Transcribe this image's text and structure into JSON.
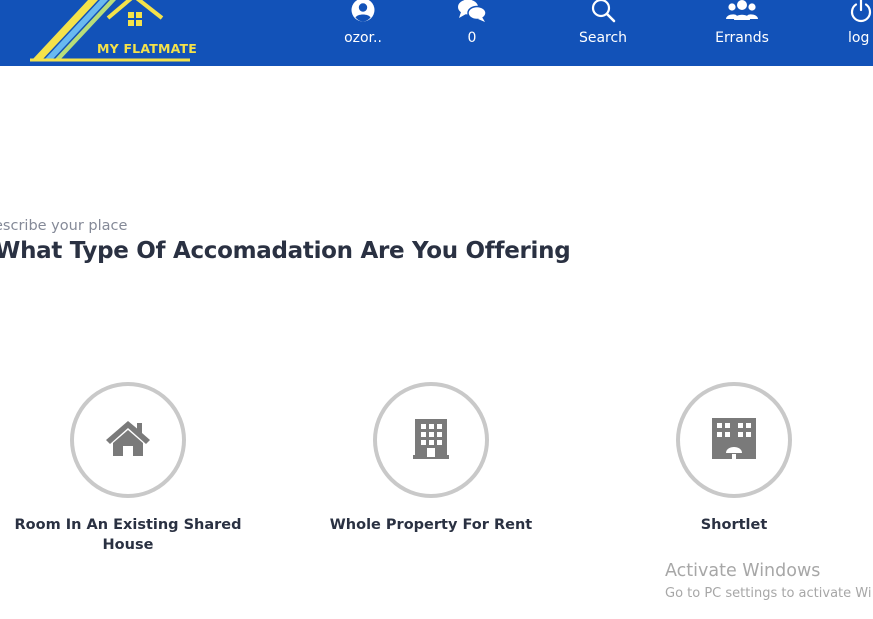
{
  "brand": {
    "name": "MY FLATMATE",
    "colors": {
      "header": "#1252b8",
      "logo_text": "#f4e24a",
      "stripe_yellow": "#f4e24a",
      "stripe_light_blue": "#69b9f0",
      "stripe_green": "#b7dd7a"
    }
  },
  "nav": {
    "profile": {
      "label": "ozor..",
      "icon": "user-circle-icon"
    },
    "messages": {
      "label": "0",
      "icon": "chat-bubbles-icon"
    },
    "search": {
      "label": "Search",
      "icon": "search-icon"
    },
    "errands": {
      "label": "Errands",
      "icon": "users-group-icon"
    },
    "logout": {
      "label": "log",
      "icon": "power-icon"
    }
  },
  "section": {
    "subtitle": "escribe your place",
    "title": "What Type Of Accomadation Are You Offering"
  },
  "options": [
    {
      "label": "Room In An Existing Shared House",
      "icon": "house-icon"
    },
    {
      "label": "Whole Property For Rent",
      "icon": "building-icon"
    },
    {
      "label": "Shortlet",
      "icon": "hotel-icon"
    }
  ],
  "watermark": {
    "title": "Activate Windows",
    "subtitle": "Go to PC settings to activate Wi"
  }
}
